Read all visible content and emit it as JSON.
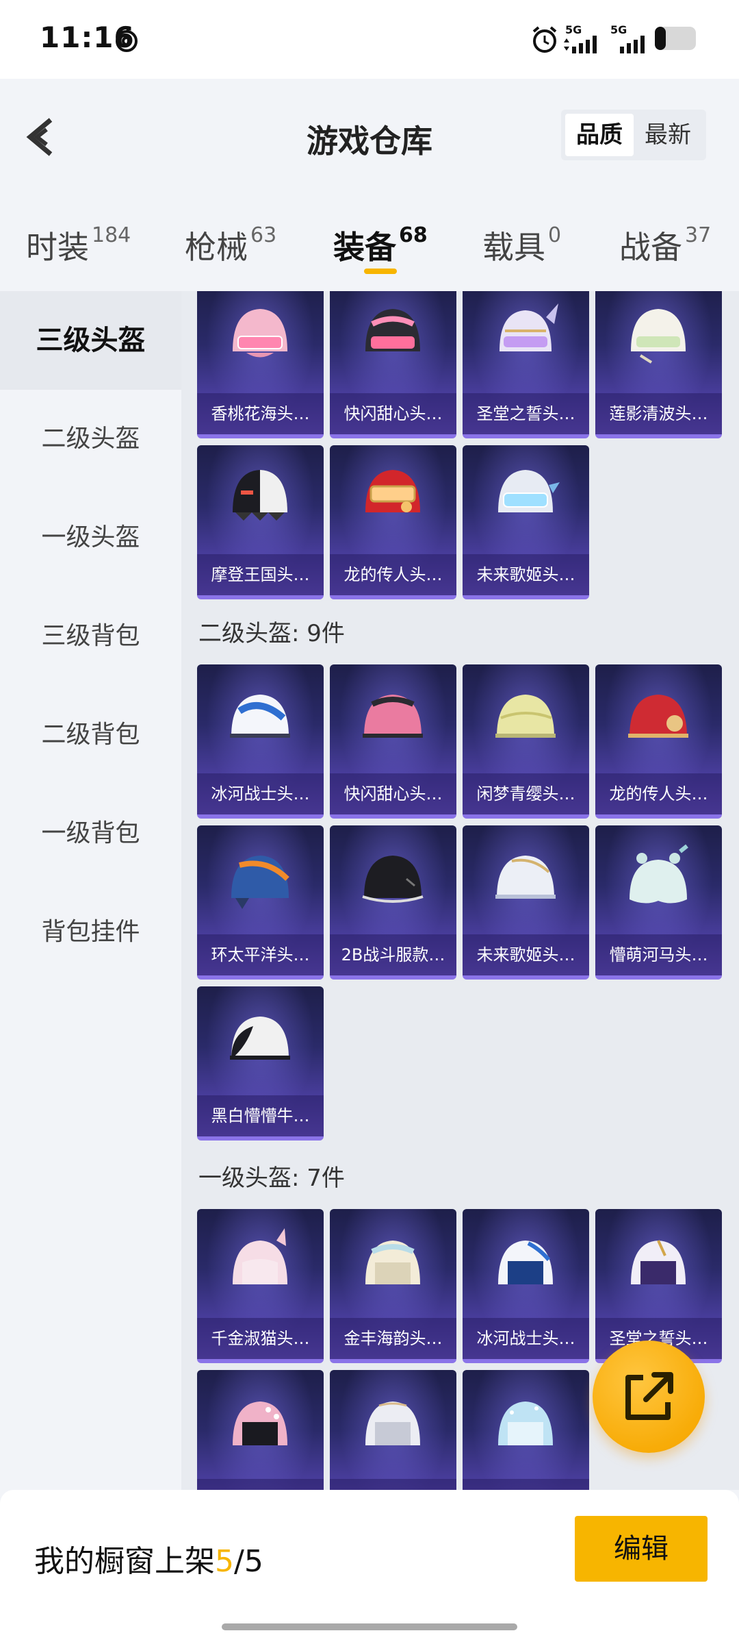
{
  "status_bar": {
    "time": "11:16",
    "network_1": "5G",
    "network_2": "5G"
  },
  "header": {
    "title": "游戏仓库",
    "sort_quality": "品质",
    "sort_latest": "最新"
  },
  "tabs": [
    {
      "label": "时装",
      "count": "184"
    },
    {
      "label": "枪械",
      "count": "63"
    },
    {
      "label": "装备",
      "count": "68"
    },
    {
      "label": "载具",
      "count": "0"
    },
    {
      "label": "战备",
      "count": "37"
    }
  ],
  "sidebar": {
    "items": [
      {
        "label": "三级头盔"
      },
      {
        "label": "二级头盔"
      },
      {
        "label": "一级头盔"
      },
      {
        "label": "三级背包"
      },
      {
        "label": "二级背包"
      },
      {
        "label": "一级背包"
      },
      {
        "label": "背包挂件"
      }
    ]
  },
  "sections": {
    "level3": {
      "items": [
        {
          "name": "香桃花海头…",
          "icon": "helmet-pink-icon"
        },
        {
          "name": "快闪甜心头…",
          "icon": "helmet-black-pink-icon"
        },
        {
          "name": "圣堂之誓头…",
          "icon": "helmet-winged-icon"
        },
        {
          "name": "莲影清波头…",
          "icon": "helmet-white-icon"
        },
        {
          "name": "摩登王国头…",
          "icon": "helmet-harlequin-icon"
        },
        {
          "name": "龙的传人头…",
          "icon": "helmet-red-icon"
        },
        {
          "name": "未来歌姬头…",
          "icon": "helmet-silver-icon"
        }
      ]
    },
    "level2": {
      "label": "二级头盔: 9件",
      "items": [
        {
          "name": "冰河战士头…",
          "icon": "helmet-blue-white-icon"
        },
        {
          "name": "快闪甜心头…",
          "icon": "helmet-pink-icon"
        },
        {
          "name": "闲梦青缨头…",
          "icon": "helmet-yellowgreen-icon"
        },
        {
          "name": "龙的传人头…",
          "icon": "helmet-red-icon"
        },
        {
          "name": "环太平洋头…",
          "icon": "helmet-mecha-icon"
        },
        {
          "name": "2B战斗服款…",
          "icon": "helmet-black-icon"
        },
        {
          "name": "未来歌姬头…",
          "icon": "helmet-white-icon"
        },
        {
          "name": "懵萌河马头…",
          "icon": "helmet-hippo-icon"
        },
        {
          "name": "黑白懵懵牛…",
          "icon": "helmet-cow-icon"
        }
      ]
    },
    "level1": {
      "label": "一级头盔: 7件",
      "items": [
        {
          "name": "千金淑猫头…",
          "icon": "helmet-cat-icon"
        },
        {
          "name": "金丰海韵头…",
          "icon": "helmet-cream-icon"
        },
        {
          "name": "冰河战士头…",
          "icon": "helmet-blue-icon"
        },
        {
          "name": "圣堂之誓头…",
          "icon": "helmet-purple-icon"
        },
        {
          "name": "",
          "icon": "helmet-pink-dots-icon"
        },
        {
          "name": "",
          "icon": "helmet-silver-icon"
        },
        {
          "name": "",
          "icon": "helmet-lightblue-icon"
        }
      ]
    }
  },
  "bottom_bar": {
    "showcase_label": "我的橱窗上架",
    "showcase_current": "5",
    "showcase_total": "/5",
    "edit_label": "编辑"
  },
  "colors": {
    "accent": "#f7b500",
    "card_top": "#1e1f4a",
    "card_bottom": "#6b55c7"
  }
}
